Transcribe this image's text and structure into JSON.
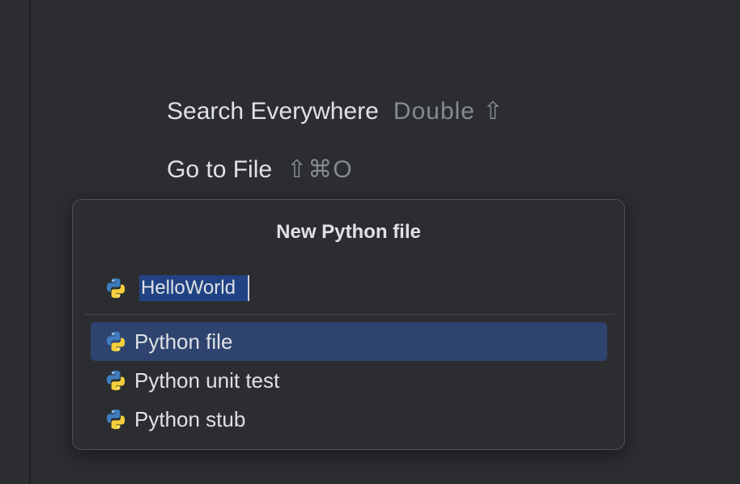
{
  "hints": [
    {
      "label": "Search Everywhere",
      "shortcut": "Double ⇧"
    },
    {
      "label": "Go to File",
      "shortcut": "⇧⌘O"
    }
  ],
  "dialog": {
    "title": "New Python file",
    "name_value": "HelloWorld",
    "templates": [
      {
        "label": "Python file",
        "icon": "python-icon",
        "selected": true
      },
      {
        "label": "Python unit test",
        "icon": "python-icon",
        "selected": false
      },
      {
        "label": "Python stub",
        "icon": "python-icon",
        "selected": false
      }
    ]
  },
  "colors": {
    "background": "#2b2d30",
    "selection": "#2e436e",
    "text_selection": "#214283",
    "python_blue": "#3f7cbd",
    "python_yellow": "#f5cf3b"
  }
}
